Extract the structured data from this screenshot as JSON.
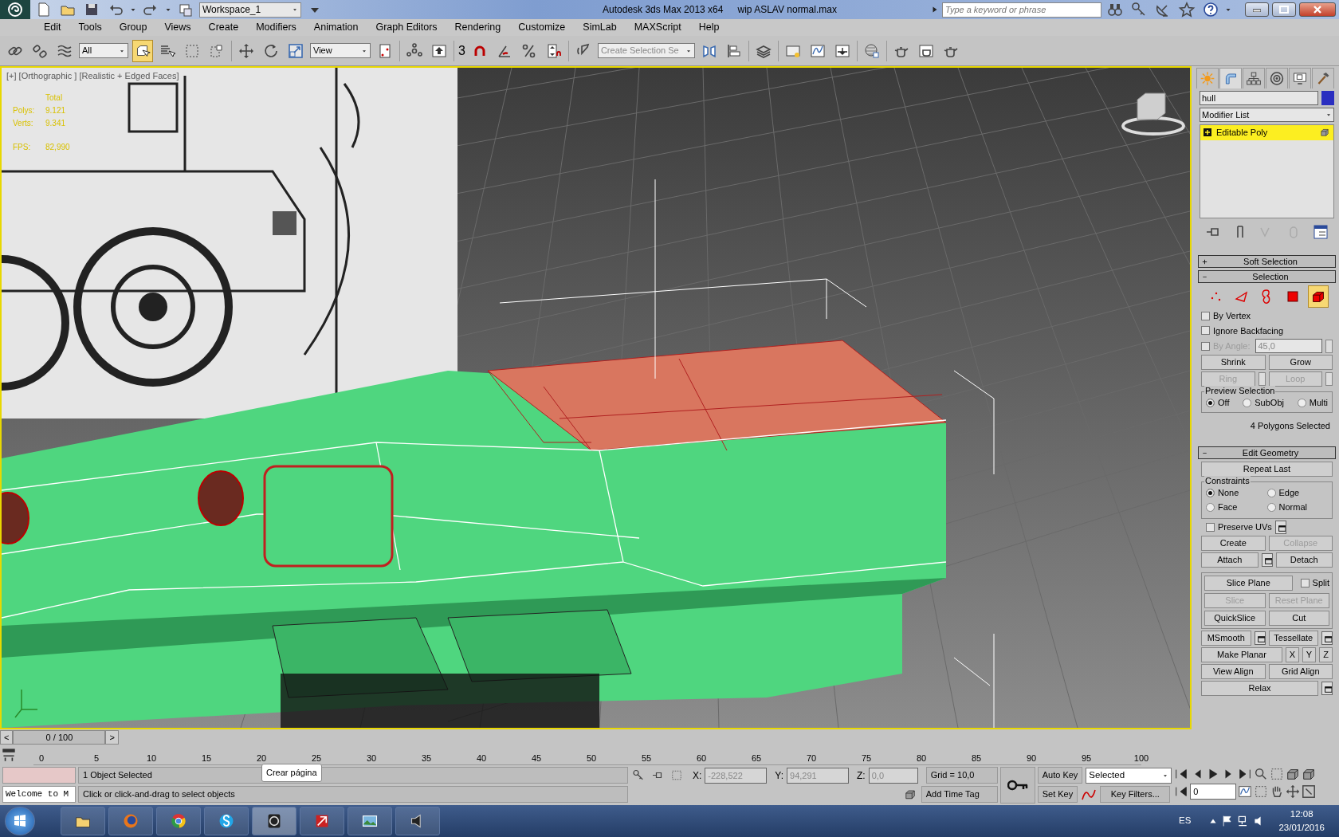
{
  "title_bar": {
    "workspace": "Workspace_1",
    "title": "Autodesk 3ds Max  2013 x64",
    "file": "wip ASLAV normal.max",
    "search": {
      "placeholder": "Type a keyword or phrase"
    }
  },
  "menu": [
    "Edit",
    "Tools",
    "Group",
    "Views",
    "Create",
    "Modifiers",
    "Animation",
    "Graph Editors",
    "Rendering",
    "Customize",
    "SimLab",
    "MAXScript",
    "Help"
  ],
  "main_toolbar": {
    "selection_filter": "All",
    "select_object_tool": {
      "selected": true
    },
    "reference_coord": "View",
    "snap_label": "3",
    "named_selection": {
      "placeholder": "Create Selection Se"
    }
  },
  "viewport": {
    "label": "[+] [Orthographic ] [Realistic + Edged Faces]",
    "stats": {
      "heading": "Total",
      "rows": [
        {
          "label": "Polys:",
          "value": "9.121"
        },
        {
          "label": "Verts:",
          "value": "9.341"
        }
      ],
      "fps": {
        "label": "FPS:",
        "value": "82,990"
      }
    }
  },
  "command_panel": {
    "tabs": [
      {
        "selected": false
      },
      {
        "selected": true
      },
      {
        "selected": false
      },
      {
        "selected": false
      },
      {
        "selected": false
      },
      {
        "selected": false
      }
    ],
    "object_name": "hull",
    "modifier_list": "Modifier List",
    "stack": [
      {
        "label": "Editable Poly",
        "selected": true
      }
    ],
    "soft_selection": {
      "title": "Soft Selection",
      "expanded": false
    },
    "selection": {
      "title": "Selection",
      "expanded": true,
      "levels": [
        {
          "selected": false
        },
        {
          "selected": false
        },
        {
          "selected": false
        },
        {
          "selected": false
        },
        {
          "selected": true
        }
      ],
      "options": [
        {
          "label": "By Vertex",
          "checked": false,
          "disabled": false
        },
        {
          "label": "Ignore Backfacing",
          "checked": false,
          "disabled": false
        },
        {
          "label": "By Angle:",
          "checked": false,
          "disabled": true,
          "value": "45,0"
        }
      ],
      "buttons": [
        {
          "label": "Shrink",
          "disabled": false,
          "spinner": false
        },
        {
          "label": "Grow",
          "disabled": false,
          "spinner": false
        },
        {
          "label": "Ring",
          "disabled": true,
          "spinner": true
        },
        {
          "label": "Loop",
          "disabled": true,
          "spinner": true
        }
      ],
      "preview": {
        "title": "Preview Selection",
        "options": [
          {
            "label": "Off",
            "selected": true
          },
          {
            "label": "SubObj",
            "selected": false
          },
          {
            "label": "Multi",
            "selected": false
          }
        ]
      },
      "info": "4 Polygons Selected"
    },
    "edit_geometry": {
      "title": "Edit Geometry",
      "expanded": true,
      "sections": [
        {
          "kind": "rows",
          "rows": [
            [
              {
                "kind": "button",
                "label": "Repeat Last",
                "disabled": false
              }
            ]
          ]
        },
        {
          "kind": "radio_group",
          "title": "Constraints",
          "options": [
            {
              "label": "None",
              "selected": true
            },
            {
              "label": "Edge",
              "selected": false
            },
            {
              "label": "Face",
              "selected": false
            },
            {
              "label": "Normal",
              "selected": false
            }
          ]
        },
        {
          "kind": "rows",
          "rows": [
            [
              {
                "kind": "checkbox",
                "label": "Preserve UVs",
                "checked": false
              },
              {
                "kind": "settings"
              }
            ],
            [
              {
                "kind": "button",
                "label": "Create",
                "disabled": false
              },
              {
                "kind": "button",
                "label": "Collapse",
                "disabled": true
              }
            ],
            [
              {
                "kind": "button",
                "label": "Attach",
                "disabled": false
              },
              {
                "kind": "settings"
              },
              {
                "kind": "button",
                "label": "Detach",
                "disabled": false
              }
            ]
          ]
        },
        {
          "kind": "group",
          "rows": [
            [
              {
                "kind": "button",
                "label": "Slice Plane",
                "disabled": false
              },
              {
                "kind": "checkbox",
                "label": "Split",
                "checked": false
              }
            ],
            [
              {
                "kind": "button",
                "label": "Slice",
                "disabled": true
              },
              {
                "kind": "button",
                "label": "Reset Plane",
                "disabled": true
              }
            ],
            [
              {
                "kind": "button",
                "label": "QuickSlice",
                "disabled": false
              },
              {
                "kind": "button",
                "label": "Cut",
                "disabled": false
              }
            ]
          ]
        },
        {
          "kind": "rows",
          "rows": [
            [
              {
                "kind": "button",
                "label": "MSmooth",
                "disabled": false
              },
              {
                "kind": "settings"
              },
              {
                "kind": "button",
                "label": "Tessellate",
                "disabled": false
              },
              {
                "kind": "settings"
              }
            ],
            [
              {
                "kind": "button",
                "label": "Make Planar",
                "disabled": false
              },
              {
                "kind": "button",
                "label": "X",
                "disabled": false
              },
              {
                "kind": "button",
                "label": "Y",
                "disabled": false
              },
              {
                "kind": "button",
                "label": "Z",
                "disabled": false
              }
            ],
            [
              {
                "kind": "button",
                "label": "View Align",
                "disabled": false
              },
              {
                "kind": "button",
                "label": "Grid Align",
                "disabled": false
              }
            ],
            [
              {
                "kind": "button",
                "label": "Relax",
                "disabled": false
              },
              {
                "kind": "settings"
              }
            ]
          ]
        }
      ]
    }
  },
  "time_slider": {
    "prev": "<",
    "position": "0 / 100",
    "next": ">",
    "ticks": [
      "0",
      "5",
      "10",
      "15",
      "20",
      "25",
      "30",
      "35",
      "40",
      "45",
      "50",
      "55",
      "60",
      "65",
      "70",
      "75",
      "80",
      "85",
      "90",
      "95",
      "100"
    ]
  },
  "status": {
    "listener": "Welcome to M",
    "selection": "1 Object Selected",
    "tooltip": "Crear página",
    "prompt": "Click or click-and-drag to select objects",
    "coords": [
      {
        "label": "X:",
        "value": "-228,522"
      },
      {
        "label": "Y:",
        "value": "94,291"
      },
      {
        "label": "Z:",
        "value": "0,0"
      }
    ],
    "grid": "Grid = 10,0",
    "time_tag": "Add Time Tag",
    "auto_key": "Auto Key",
    "set_key": "Set Key",
    "key_mode": "Selected",
    "key_filters": "Key Filters...",
    "frame": "0"
  },
  "taskbar": {
    "apps": [
      {
        "selected": false
      },
      {
        "selected": false
      },
      {
        "selected": false
      },
      {
        "selected": false
      },
      {
        "selected": true
      },
      {
        "selected": false
      },
      {
        "selected": false
      },
      {
        "selected": false
      }
    ],
    "language": "ES",
    "time": "12:08",
    "date": "23/01/2016"
  }
}
